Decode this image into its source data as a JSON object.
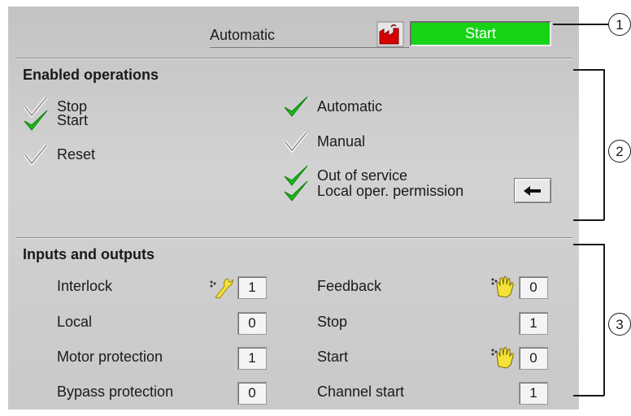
{
  "header": {
    "mode_label": "Automatic",
    "status_button": "Start",
    "mode_icon": "local-plant-icon",
    "status_color": "#17d417"
  },
  "enabled_operations": {
    "heading": "Enabled operations",
    "left": [
      {
        "label": "Stop",
        "enabled": false
      },
      {
        "label": "Start",
        "enabled": true
      },
      {
        "label": "Reset",
        "enabled": false
      }
    ],
    "right": [
      {
        "label": "Automatic",
        "enabled": true
      },
      {
        "label": "Manual",
        "enabled": false
      },
      {
        "label": "Out of service",
        "enabled": true
      },
      {
        "label": "Local oper. permission",
        "enabled": true
      }
    ],
    "permission_button_icon": "arrow-left-icon"
  },
  "inputs_outputs": {
    "heading": "Inputs and outputs",
    "left": [
      {
        "label": "Interlock",
        "value": "1",
        "icon": "wrench-icon"
      },
      {
        "label": "Local",
        "value": "0"
      },
      {
        "label": "Motor protection",
        "value": "1"
      },
      {
        "label": "Bypass protection",
        "value": "0"
      }
    ],
    "right": [
      {
        "label": "Feedback",
        "value": "0",
        "icon": "simulation-hand-icon"
      },
      {
        "label": "Stop",
        "value": "1"
      },
      {
        "label": "Start",
        "value": "0",
        "icon": "simulation-hand-icon"
      },
      {
        "label": "Channel start",
        "value": "1"
      }
    ]
  },
  "callouts": [
    "1",
    "2",
    "3"
  ]
}
